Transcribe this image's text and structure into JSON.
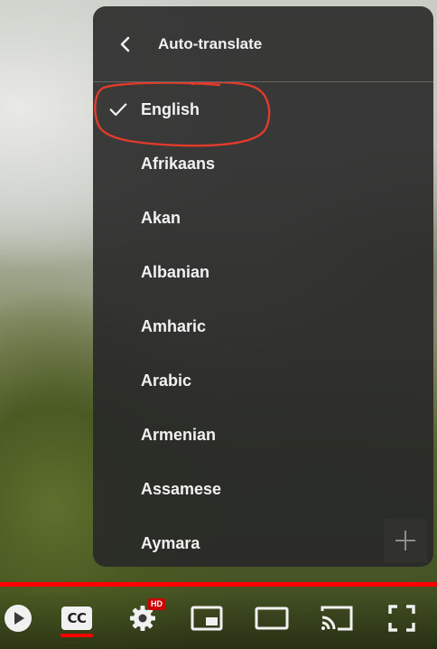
{
  "player": {
    "progress_fraction": 1.0,
    "accent_color": "#ff0000"
  },
  "menu": {
    "title": "Auto-translate",
    "back_icon": "chevron-left-icon",
    "selected_index": 0,
    "items": [
      {
        "label": "English",
        "selected": true
      },
      {
        "label": "Afrikaans",
        "selected": false
      },
      {
        "label": "Akan",
        "selected": false
      },
      {
        "label": "Albanian",
        "selected": false
      },
      {
        "label": "Amharic",
        "selected": false
      },
      {
        "label": "Arabic",
        "selected": false
      },
      {
        "label": "Armenian",
        "selected": false
      },
      {
        "label": "Assamese",
        "selected": false
      },
      {
        "label": "Aymara",
        "selected": false
      }
    ],
    "annotation_color": "#e03a2b"
  },
  "controls": {
    "play_icon": "play-icon",
    "captions_label": "CC",
    "settings_icon": "gear-icon",
    "quality_badge": "HD",
    "miniplayer_icon": "miniplayer-icon",
    "theater_icon": "theater-mode-icon",
    "cast_icon": "cast-icon",
    "fullscreen_icon": "fullscreen-icon",
    "add_icon": "plus-icon"
  }
}
